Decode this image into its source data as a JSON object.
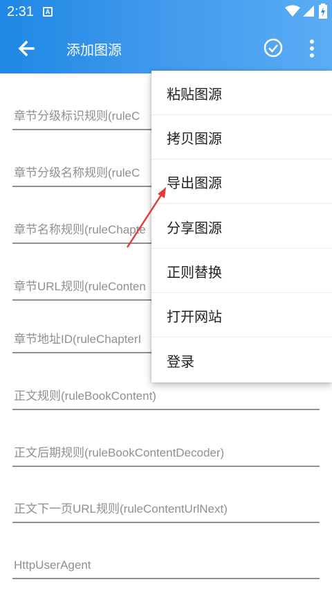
{
  "status_bar": {
    "time": "2:31",
    "notification_icon": "A"
  },
  "toolbar": {
    "title": "添加图源",
    "back_icon": "arrow-left-icon",
    "confirm_icon": "check-circle-icon",
    "more_icon": "more-vert-icon"
  },
  "form": {
    "fields": [
      {
        "hint": "章节分级标识规则(ruleC"
      },
      {
        "hint": "章节分级名称规则(ruleC"
      },
      {
        "hint": "章节名称规则(ruleChapte"
      },
      {
        "hint": "章节URL规则(ruleConten"
      },
      {
        "hint": "章节地址ID(ruleChapterI"
      },
      {
        "hint": "正文规则(ruleBookContent)"
      },
      {
        "hint": "正文后期规则(ruleBookContentDecoder)"
      },
      {
        "hint": "正文下一页URL规则(ruleContentUrlNext)"
      },
      {
        "hint": "HttpUserAgent"
      }
    ]
  },
  "menu": {
    "items": [
      {
        "label": "粘贴图源"
      },
      {
        "label": "拷贝图源"
      },
      {
        "label": "导出图源"
      },
      {
        "label": "分享图源"
      },
      {
        "label": "正则替换"
      },
      {
        "label": "打开网站"
      },
      {
        "label": "登录"
      }
    ]
  },
  "colors": {
    "accent": "#1e88e5",
    "annotation_arrow": "#e53935"
  }
}
